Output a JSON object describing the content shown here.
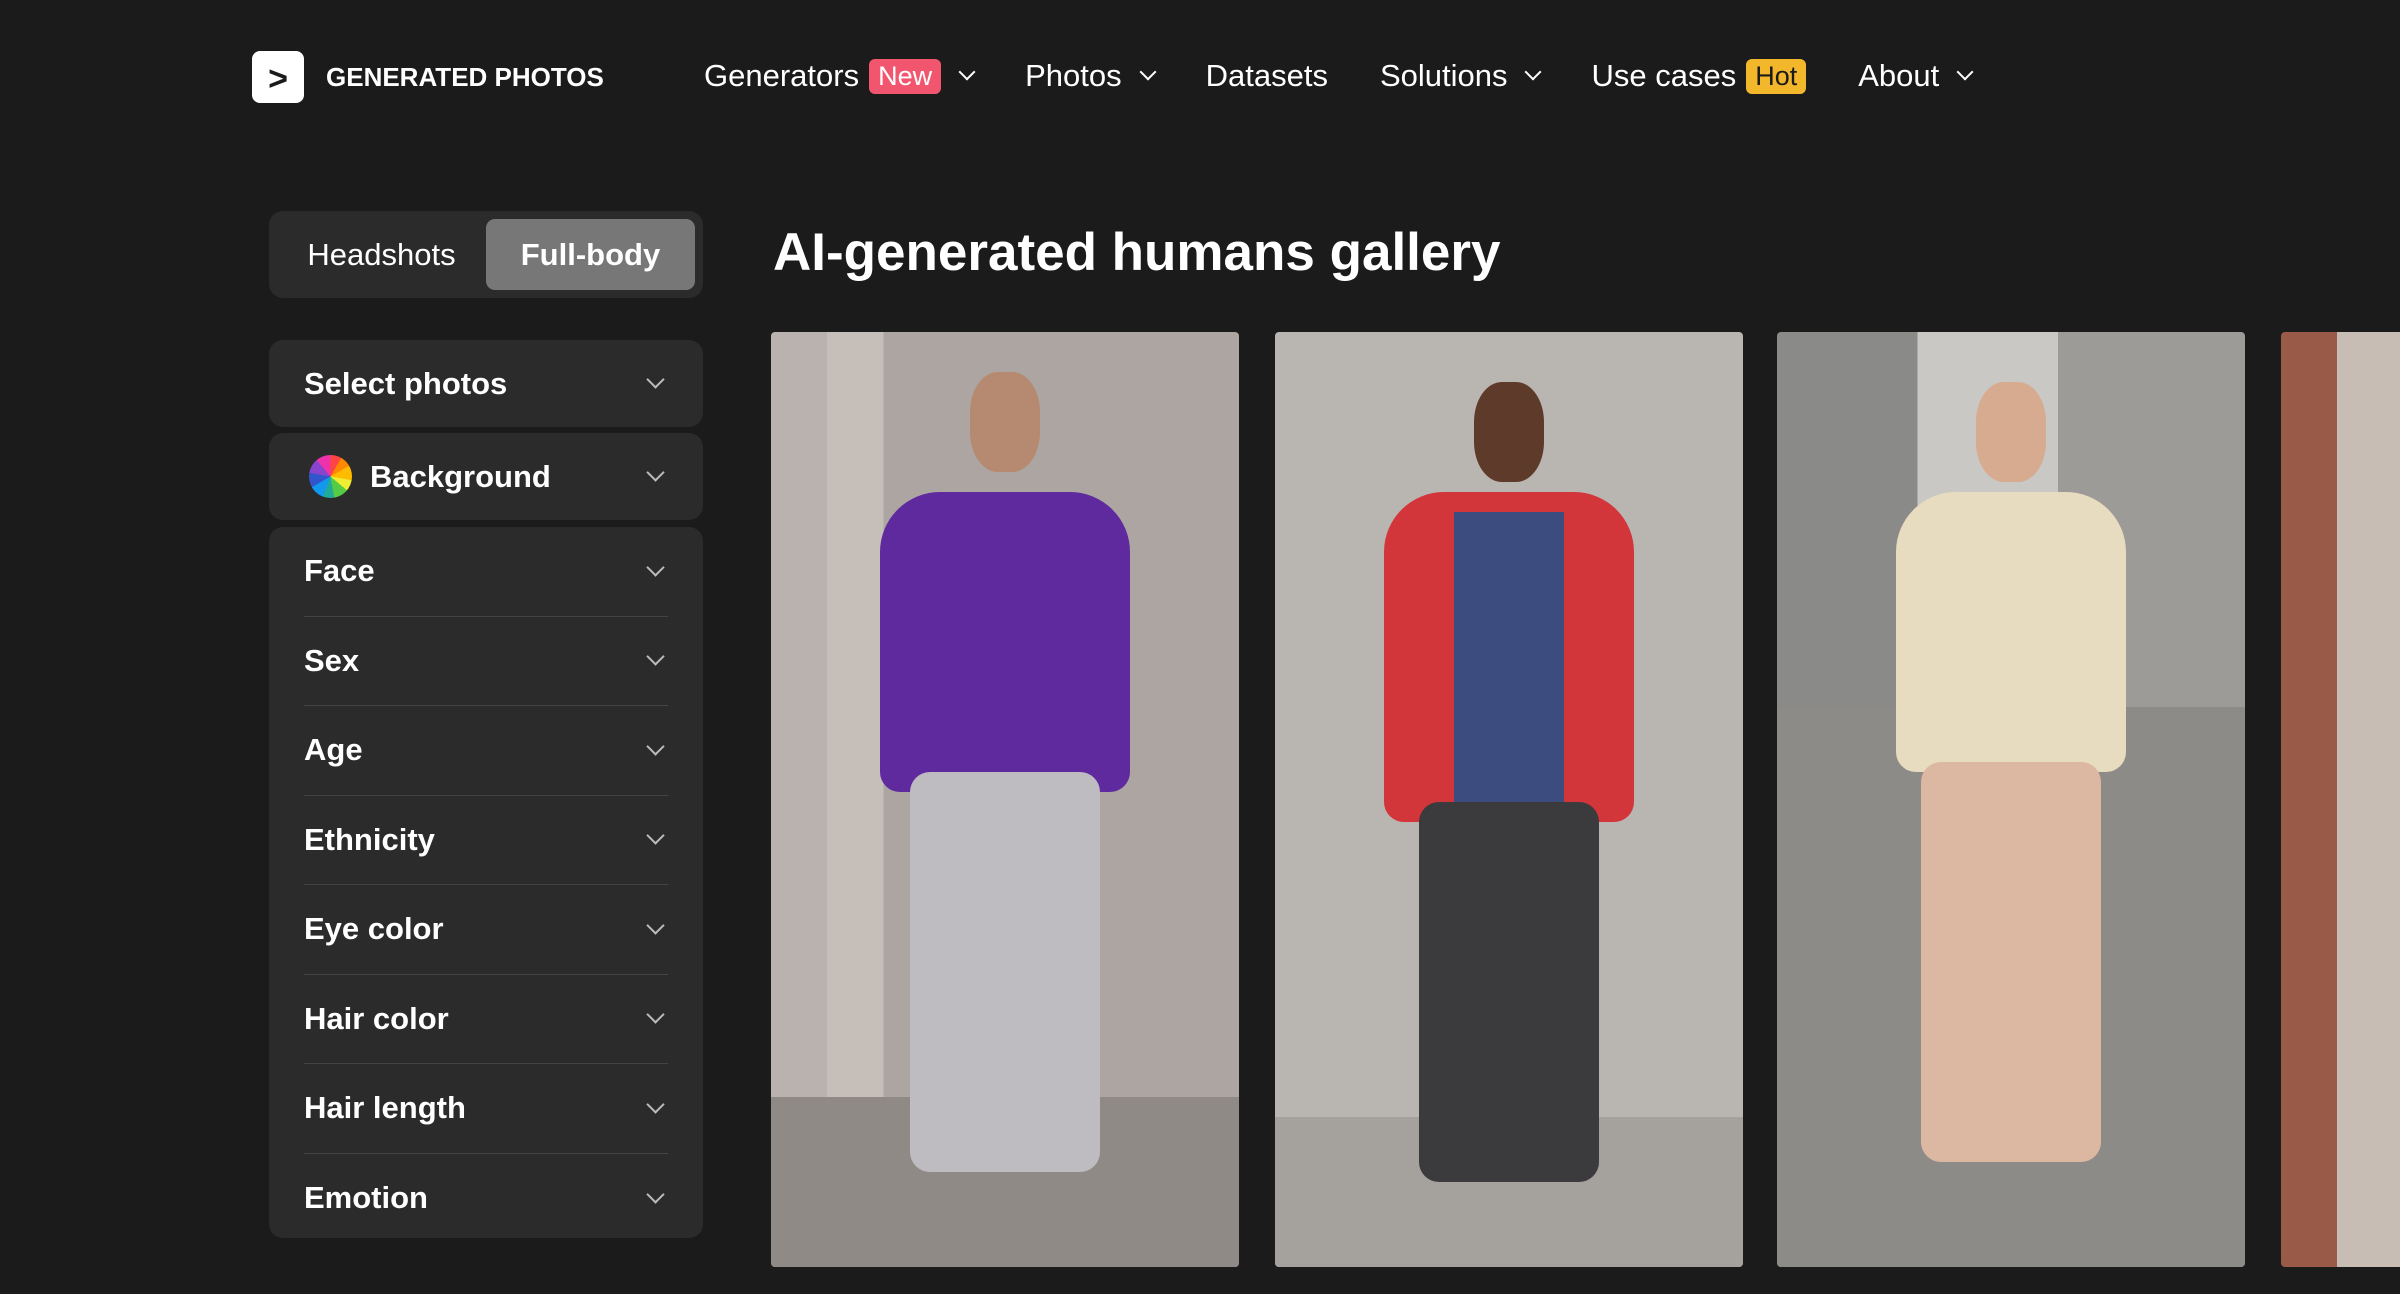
{
  "header": {
    "logo_text": "GENERATED PHOTOS",
    "logo_glyph": ">",
    "nav": [
      {
        "label": "Generators",
        "badge": "New",
        "dropdown": true
      },
      {
        "label": "Photos",
        "dropdown": true
      },
      {
        "label": "Datasets",
        "dropdown": false
      },
      {
        "label": "Solutions",
        "dropdown": true
      },
      {
        "label": "Use cases",
        "badge": "Hot",
        "dropdown": false
      },
      {
        "label": "About",
        "dropdown": true
      }
    ],
    "badge_colors": {
      "new": "#f2566f",
      "hot": "#f3b72b"
    }
  },
  "sidebar": {
    "tabs": [
      {
        "label": "Headshots",
        "active": false
      },
      {
        "label": "Full-body",
        "active": true
      }
    ],
    "select_photos": "Select photos",
    "background": "Background",
    "filters": [
      "Face",
      "Sex",
      "Age",
      "Ethnicity",
      "Eye color",
      "Hair color",
      "Hair length",
      "Emotion"
    ]
  },
  "main": {
    "title": "AI-generated humans gallery"
  }
}
